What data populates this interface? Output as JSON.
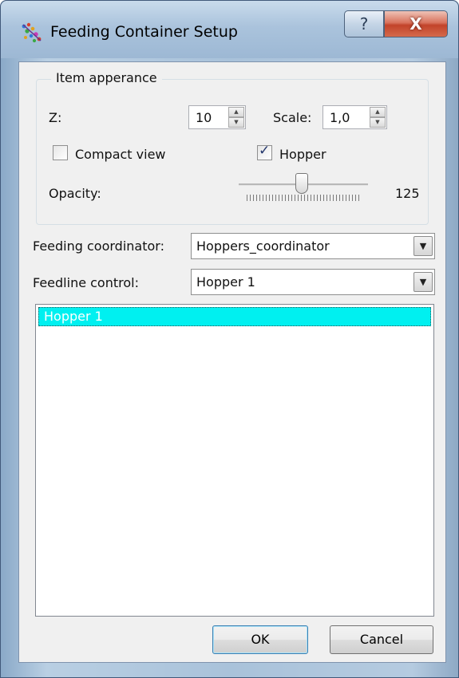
{
  "window": {
    "title": "Feeding Container Setup",
    "help_glyph": "?",
    "close_glyph": "X"
  },
  "item_appearance": {
    "group_title": "Item apperance",
    "z_label": "Z:",
    "z_value": "10",
    "scale_label": "Scale:",
    "scale_value": "1,0",
    "compact_view_label": "Compact view",
    "compact_view_checked": false,
    "hopper_label": "Hopper",
    "hopper_checked": true,
    "opacity_label": "Opacity:",
    "opacity_value": "125"
  },
  "feeding_coordinator": {
    "label": "Feeding coordinator:",
    "value": "Hoppers_coordinator"
  },
  "feedline_control": {
    "label": "Feedline control:",
    "value": "Hopper 1"
  },
  "list": {
    "items": [
      "Hopper 1"
    ],
    "selected_color": "#00f0f0"
  },
  "buttons": {
    "ok_label": "OK",
    "cancel_label": "Cancel"
  },
  "icons": {
    "app": "colorful-dots-icon",
    "spin_up": "spin-up-arrow-icon",
    "spin_down": "spin-down-arrow-icon",
    "dropdown": "dropdown-arrow-icon"
  }
}
